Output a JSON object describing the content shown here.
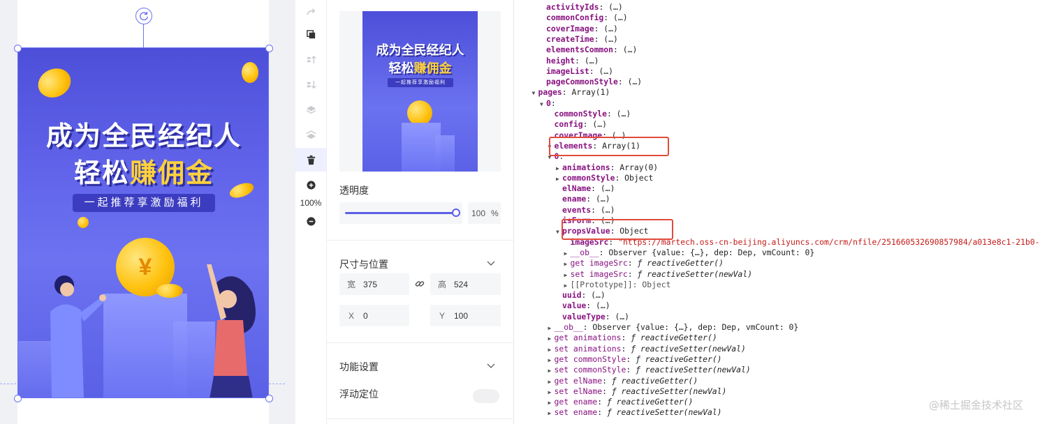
{
  "colors": {
    "accent": "#5b5fe6",
    "poster_bg": "#5b61e6",
    "highlight": "#e14a3a",
    "gold": "#ffd23c"
  },
  "poster": {
    "title_line1": "成为全民经纪人",
    "title_line2_prefix": "轻松",
    "title_line2_highlight": "赚佣金",
    "subtitle": "一起推荐享激励福利",
    "coin_symbol": "¥"
  },
  "toolbar": {
    "tools": [
      "redo-icon",
      "copy-icon",
      "move-up-icon",
      "move-down-icon",
      "layer-up-icon",
      "layer-down-icon",
      "delete-icon",
      "zoom-in-icon",
      "zoom-out-icon"
    ],
    "zoom": "100%"
  },
  "panel": {
    "opacity_label": "透明度",
    "opacity_value": "100",
    "opacity_unit": "%",
    "size_position_title": "尺寸与位置",
    "width_label": "宽",
    "width_value": "375",
    "height_label": "高",
    "height_value": "524",
    "x_label": "X",
    "x_value": "0",
    "y_label": "Y",
    "y_value": "100",
    "function_title": "功能设置",
    "float_label": "浮动定位",
    "float_enabled": false
  },
  "devtools": {
    "lines": [
      {
        "indent": 0,
        "tri": "",
        "key": "activityIds",
        "rest": " (…)"
      },
      {
        "indent": 0,
        "tri": "",
        "key": "commonConfig",
        "rest": " (…)"
      },
      {
        "indent": 0,
        "tri": "",
        "key": "coverImage",
        "rest": " (…)"
      },
      {
        "indent": 0,
        "tri": "",
        "key": "createTime",
        "rest": " (…)"
      },
      {
        "indent": 0,
        "tri": "",
        "key": "elementsCommon",
        "rest": " (…)"
      },
      {
        "indent": 0,
        "tri": "",
        "key": "height",
        "rest": " (…)"
      },
      {
        "indent": 0,
        "tri": "",
        "key": "imageList",
        "rest": " (…)"
      },
      {
        "indent": 0,
        "tri": "",
        "key": "pageCommonStyle",
        "rest": " (…)"
      },
      {
        "indent": -1,
        "tri": "▼",
        "key": "pages",
        "rest": " Array(1)"
      },
      {
        "indent": 0,
        "tri": "▼",
        "key": "0",
        "rest": ""
      },
      {
        "indent": 1,
        "tri": "",
        "key": "commonStyle",
        "rest": " (…)"
      },
      {
        "indent": 1,
        "tri": "",
        "key": "config",
        "rest": " (…)"
      },
      {
        "indent": 1,
        "tri": "",
        "key": "coverImage",
        "rest": " (…)"
      },
      {
        "indent": 1,
        "tri": "▼",
        "key": "elements",
        "rest": " Array(1)"
      },
      {
        "indent": 1,
        "tri": "▼",
        "key": "0",
        "rest": ""
      },
      {
        "indent": 2,
        "tri": "▶",
        "key": "animations",
        "rest": " Array(0)"
      },
      {
        "indent": 2,
        "tri": "▶",
        "key": "commonStyle",
        "rest": " Object"
      },
      {
        "indent": 2,
        "tri": "",
        "key": "elName",
        "rest": " (…)"
      },
      {
        "indent": 2,
        "tri": "",
        "key": "ename",
        "rest": " (…)"
      },
      {
        "indent": 2,
        "tri": "",
        "key": "events",
        "rest": " (…)"
      },
      {
        "indent": 2,
        "tri": "",
        "key": "isForm",
        "rest": " (…)"
      },
      {
        "indent": 2,
        "tri": "▼",
        "key": "propsValue",
        "rest": " Object"
      },
      {
        "indent": 3,
        "tri": "",
        "key": "imageSrc",
        "str": " \"https://martech.oss-cn-beijing.aliyuncs.com/crm/nfile/251660532690857984/a013e8c1-21b0-"
      },
      {
        "indent": 3,
        "tri": "▶",
        "keyn": "__ob__",
        "rest": " Observer {value: {…}, dep: Dep, vmCount: 0}"
      },
      {
        "indent": 3,
        "tri": "▶",
        "keyn": "get imageSrc",
        "fn": " ƒ reactiveGetter()"
      },
      {
        "indent": 3,
        "tri": "▶",
        "keyn": "set imageSrc",
        "fn": " ƒ reactiveSetter(newVal)"
      },
      {
        "indent": 3,
        "tri": "▶",
        "plain": "[[Prototype]]: Object"
      },
      {
        "indent": 2,
        "tri": "",
        "key": "uuid",
        "rest": " (…)"
      },
      {
        "indent": 2,
        "tri": "",
        "key": "value",
        "rest": " (…)"
      },
      {
        "indent": 2,
        "tri": "",
        "key": "valueType",
        "rest": " (…)"
      },
      {
        "indent": 1,
        "tri": "▶",
        "keyn": "__ob__",
        "rest": " Observer {value: {…}, dep: Dep, vmCount: 0}"
      },
      {
        "indent": 1,
        "tri": "▶",
        "keyn": "get animations",
        "fn": " ƒ reactiveGetter()"
      },
      {
        "indent": 1,
        "tri": "▶",
        "keyn": "set animations",
        "fn": " ƒ reactiveSetter(newVal)"
      },
      {
        "indent": 1,
        "tri": "▶",
        "keyn": "get commonStyle",
        "fn": " ƒ reactiveGetter()"
      },
      {
        "indent": 1,
        "tri": "▶",
        "keyn": "set commonStyle",
        "fn": " ƒ reactiveSetter(newVal)"
      },
      {
        "indent": 1,
        "tri": "▶",
        "keyn": "get elName",
        "fn": " ƒ reactiveGetter()"
      },
      {
        "indent": 1,
        "tri": "▶",
        "keyn": "set elName",
        "fn": " ƒ reactiveSetter(newVal)"
      },
      {
        "indent": 1,
        "tri": "▶",
        "keyn": "get ename",
        "fn": " ƒ reactiveGetter()"
      },
      {
        "indent": 1,
        "tri": "▶",
        "keyn": "set ename",
        "fn": " ƒ reactiveSetter(newVal)"
      }
    ]
  },
  "watermark": "@稀土掘金技术社区"
}
